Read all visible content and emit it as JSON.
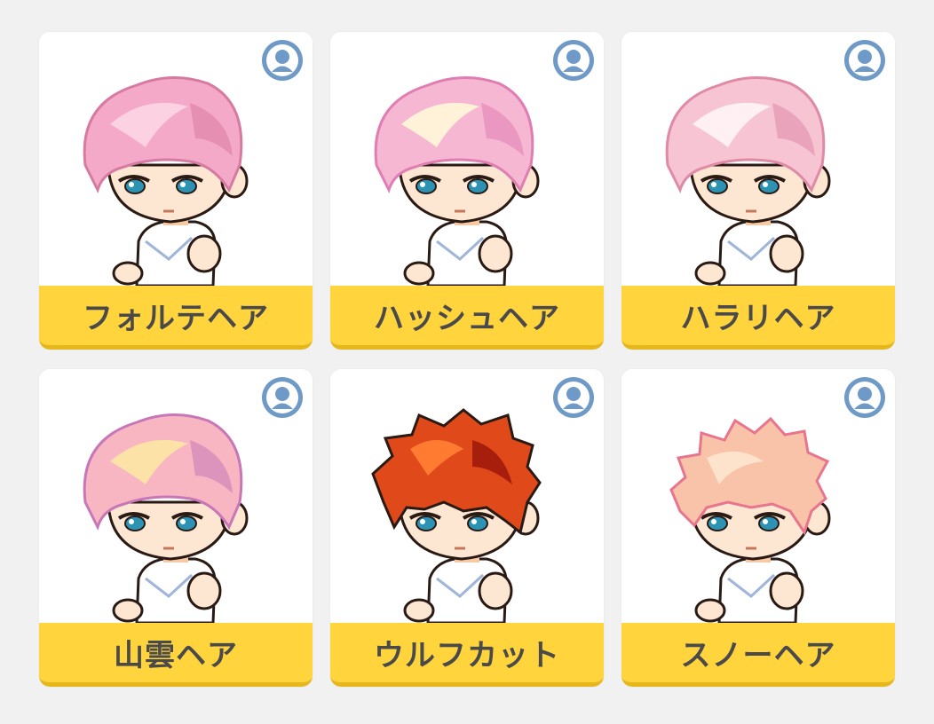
{
  "items": [
    {
      "label": "フォルテヘア",
      "hair": "#f5a9c8",
      "hair_dark": "#d77aa2",
      "hair_light": "#fcd2e2"
    },
    {
      "label": "ハッシュヘア",
      "hair": "#f6b7d2",
      "hair_dark": "#e07db2",
      "hair_light": "#fff2d8"
    },
    {
      "label": "ハラリヘア",
      "hair": "#f7c4d4",
      "hair_dark": "#df8aa6",
      "hair_light": "#fff0f4"
    },
    {
      "label": "山雲ヘア",
      "hair": "#f7b6c2",
      "hair_dark": "#c777b8",
      "hair_light": "#fde2a8"
    },
    {
      "label": "ウルフカット",
      "hair": "#e0491a",
      "hair_dark": "#a81e0c",
      "hair_light": "#ff7b32"
    },
    {
      "label": "スノーヘア",
      "hair": "#f8c3a8",
      "hair_dark": "#e8758e",
      "hair_light": "#fde3cc"
    }
  ],
  "badge": {
    "icon": "person-icon",
    "color": "#6f9ac7"
  },
  "colors": {
    "label_bg": "#ffd43c",
    "label_border": "#e5b71a",
    "label_text": "#4a4a4a",
    "page_bg": "#f1f1f1"
  }
}
